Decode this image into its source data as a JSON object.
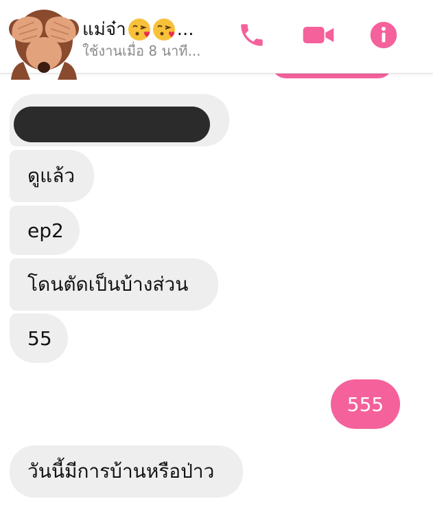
{
  "header": {
    "contact_name": "แม่จ๋า",
    "name_ellipsis": "...",
    "status": "ใช้งานเมื่อ 8 นาที...",
    "icons": [
      "phone-icon",
      "video-camera-icon",
      "info-icon"
    ],
    "accent_color": "#f4619b"
  },
  "messages": [
    {
      "direction": "received",
      "text": "",
      "redacted": true
    },
    {
      "direction": "received",
      "text": "ดูแล้ว"
    },
    {
      "direction": "received",
      "text": "ep2"
    },
    {
      "direction": "received",
      "text": "โดนตัดเป็นบ้างส่วน"
    },
    {
      "direction": "received",
      "text": "55"
    },
    {
      "direction": "sent",
      "text": "555"
    },
    {
      "direction": "received",
      "text": "วันนี้มีการบ้านหรือป่าว"
    }
  ]
}
